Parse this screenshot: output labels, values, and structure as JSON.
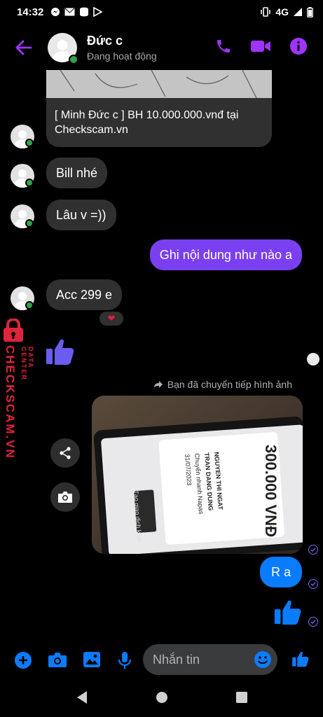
{
  "status": {
    "time": "14:32",
    "network": "4G"
  },
  "header": {
    "name": "Đức c",
    "status": "Đang hoạt động",
    "icons": [
      "back-arrow-icon",
      "phone-icon",
      "video-icon",
      "info-icon"
    ]
  },
  "messages": {
    "link_card_text": "[ Minh Đức c ] BH 10.000.000.vnđ tại Checkscam.vn",
    "bill": "Bill nhé",
    "lau": "Lâu v =))",
    "out_ghi": "Ghi nội dung như nào a",
    "acc": "Acc 299 e",
    "reaction": "❤",
    "forwarded": "Bạn đã chuyển tiếp hình ảnh",
    "out_ra": "R a"
  },
  "photo": {
    "amount_text": "300.000 VNĐ",
    "lines": [
      "NGUYEN THI NGAT",
      "TRAN DANG DUNG",
      "Chuyển nhanh Napas",
      "31/07/2023",
      "Tạo giao dịch khác"
    ]
  },
  "watermark": {
    "text_main": "CHECKSCAM.VN",
    "text_sub": "DATA CENTER"
  },
  "composer": {
    "placeholder": "Nhắn tin"
  },
  "colors": {
    "accent": "#a033ff",
    "outgoing": "#7b3ff2",
    "outgoing_blue": "#0a7cff",
    "incoming": "#303030",
    "online": "#31a24c"
  }
}
